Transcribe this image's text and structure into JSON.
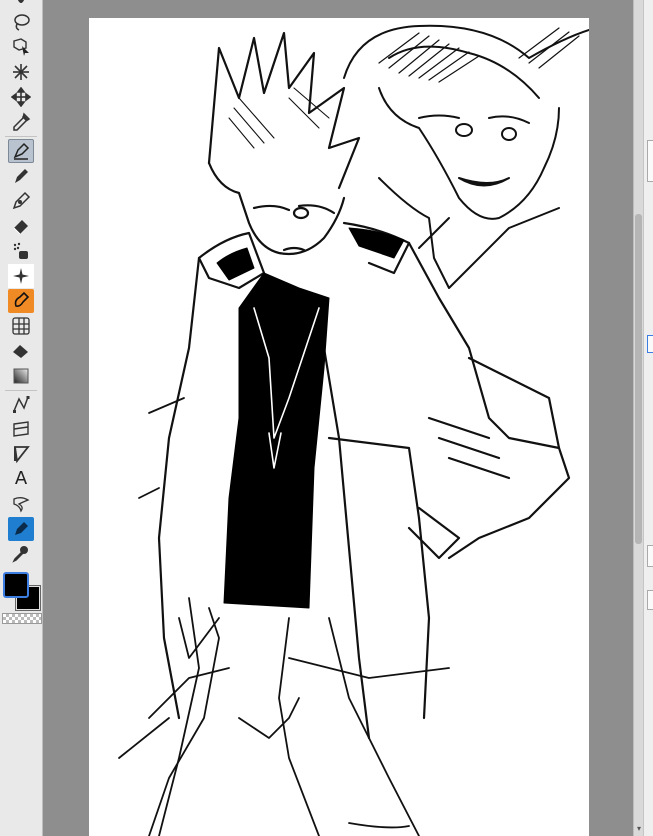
{
  "toolbar": {
    "tools": [
      {
        "name": "brush-tip-icon"
      },
      {
        "name": "lasso-icon"
      },
      {
        "name": "object-select-icon"
      },
      {
        "name": "magic-wand-icon"
      },
      {
        "name": "move-icon"
      },
      {
        "name": "eyedropper-icon"
      },
      {
        "name": "pen-icon",
        "selected": true
      },
      {
        "name": "pencil-icon"
      },
      {
        "name": "brush-icon"
      },
      {
        "name": "eraser-icon"
      },
      {
        "name": "blend-icon"
      },
      {
        "name": "sparkle-icon"
      },
      {
        "name": "fill-icon"
      },
      {
        "name": "perspective-grid-icon"
      },
      {
        "name": "paint-bucket-icon"
      },
      {
        "name": "gradient-icon"
      },
      {
        "name": "vector-line-icon"
      },
      {
        "name": "ruler-icon"
      },
      {
        "name": "frame-icon"
      },
      {
        "name": "text-tool-icon",
        "label": "A"
      },
      {
        "name": "speech-balloon-icon"
      },
      {
        "name": "correct-line-icon"
      },
      {
        "name": "eyedropper-alt-icon"
      }
    ],
    "foreground_color": "#000000",
    "background_color": "#000000"
  },
  "colors": {
    "workspace": "#8e8e8e",
    "canvas": "#ffffff",
    "selected_tool": "#b9c3cf",
    "accent_orange": "#f08a24",
    "accent_blue": "#1f7ed0"
  },
  "canvas": {
    "content": "sketch-illustration"
  },
  "scrollbar": {
    "down_arrow": "▾"
  }
}
